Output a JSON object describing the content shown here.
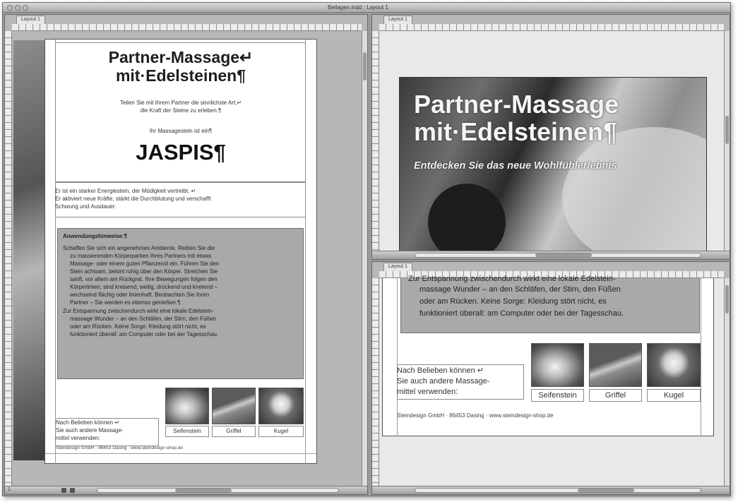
{
  "window": {
    "title": "Beilagen.indd : Layout 1"
  },
  "tabs": {
    "left": "Layout 1",
    "right_top": "Layout 1",
    "right_bottom": "Layout 1"
  },
  "document": {
    "title_line1": "Partner-Massage↵",
    "title_line2": "mit·Edelsteinen¶",
    "intro_line1": "Teilen Sie mit Ihrem Partner die sinnlichste Art,↵",
    "intro_line2": "die Kraft der Steine zu erleben.¶",
    "stone_intro": "Ihr Massagestein ist ein¶",
    "stone_name": "JASPIS¶",
    "description_line1": "Er ist ein starker Energiestein, der Müdigkeit vertreibt. ↵",
    "description_line2": "Er aktiviert neue Kräfte, stärkt die Durchblutung und verschafft",
    "description_line3": "Schwung und Ausdauer.",
    "hints_heading": "Anwendungshinweise:¶",
    "hints_lines": [
      "Schaffen Sie sich ein angenehmes Ambiente. Reiben Sie die",
      "zu massierenden Körperpartien Ihres Partners mit etwas",
      "Massage- oder einem guten Pflanzenöl ein. Führen Sie den",
      "Stein achtsam, betont ruhig über den Körper. Streichen Sie",
      "sanft, vor allem am Rückgrat. Ihre Bewegungen folgen den",
      "Körperlinien, sind kreisend, wellig, drückend und knetend –",
      "wechselnd flächig oder linienhaft. Beobachten Sie Ihren",
      "Partner – Sie werden es ebenso genießen.¶",
      "Zur Entspannung zwischendurch wirkt eine lokale Edelstein-",
      "massage Wunder – an den Schläfen, der Stirn, den Füßen",
      "oder am Rücken. Keine Sorge: Kleidung stört nicht, es",
      "funktioniert überall: am Computer oder bei der Tagesschau."
    ],
    "extras_line1": "Nach·Belieben können·↵",
    "extras_line2": "Sie auch andere Massage-",
    "extras_line3": "mittel verwenden:",
    "stones": [
      "Seifenstein",
      "Griffel",
      "Kugel"
    ],
    "footer": "Steindesign GmbH · 86453 Dasing · www.steindesign-shop.de"
  },
  "hero": {
    "title_line1": "Partner-Massage",
    "title_line2": "mit·Edelsteinen¶",
    "subtitle": "Entdecken Sie das neue Wohlfühlerlebnis"
  },
  "zoom_detail": {
    "lines": [
      "Zur Entspannung zwischendurch wirkt eine lokale Edelstein-",
      "massage Wunder – an den Schläfen, der Stirn, den Füßen",
      "oder am Rücken. Keine Sorge: Kleidung stört nicht, es",
      "funktioniert überall: am Computer oder bei der Tagesschau."
    ],
    "extras_line1": "Nach Belieben können ↵",
    "extras_line2": "Sie auch andere Massage-",
    "extras_line3": "mittel verwenden:"
  },
  "colors": {
    "box_grey": "#a9a9a9",
    "chrome": "#b7b7b7"
  }
}
